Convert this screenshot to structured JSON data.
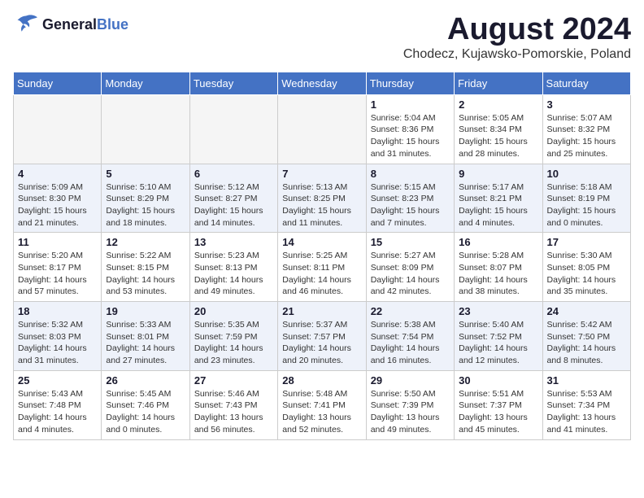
{
  "header": {
    "logo_line1": "General",
    "logo_line2": "Blue",
    "month_year": "August 2024",
    "location": "Chodecz, Kujawsko-Pomorskie, Poland"
  },
  "weekdays": [
    "Sunday",
    "Monday",
    "Tuesday",
    "Wednesday",
    "Thursday",
    "Friday",
    "Saturday"
  ],
  "weeks": [
    [
      {
        "day": "",
        "info": ""
      },
      {
        "day": "",
        "info": ""
      },
      {
        "day": "",
        "info": ""
      },
      {
        "day": "",
        "info": ""
      },
      {
        "day": "1",
        "info": "Sunrise: 5:04 AM\nSunset: 8:36 PM\nDaylight: 15 hours\nand 31 minutes."
      },
      {
        "day": "2",
        "info": "Sunrise: 5:05 AM\nSunset: 8:34 PM\nDaylight: 15 hours\nand 28 minutes."
      },
      {
        "day": "3",
        "info": "Sunrise: 5:07 AM\nSunset: 8:32 PM\nDaylight: 15 hours\nand 25 minutes."
      }
    ],
    [
      {
        "day": "4",
        "info": "Sunrise: 5:09 AM\nSunset: 8:30 PM\nDaylight: 15 hours\nand 21 minutes."
      },
      {
        "day": "5",
        "info": "Sunrise: 5:10 AM\nSunset: 8:29 PM\nDaylight: 15 hours\nand 18 minutes."
      },
      {
        "day": "6",
        "info": "Sunrise: 5:12 AM\nSunset: 8:27 PM\nDaylight: 15 hours\nand 14 minutes."
      },
      {
        "day": "7",
        "info": "Sunrise: 5:13 AM\nSunset: 8:25 PM\nDaylight: 15 hours\nand 11 minutes."
      },
      {
        "day": "8",
        "info": "Sunrise: 5:15 AM\nSunset: 8:23 PM\nDaylight: 15 hours\nand 7 minutes."
      },
      {
        "day": "9",
        "info": "Sunrise: 5:17 AM\nSunset: 8:21 PM\nDaylight: 15 hours\nand 4 minutes."
      },
      {
        "day": "10",
        "info": "Sunrise: 5:18 AM\nSunset: 8:19 PM\nDaylight: 15 hours\nand 0 minutes."
      }
    ],
    [
      {
        "day": "11",
        "info": "Sunrise: 5:20 AM\nSunset: 8:17 PM\nDaylight: 14 hours\nand 57 minutes."
      },
      {
        "day": "12",
        "info": "Sunrise: 5:22 AM\nSunset: 8:15 PM\nDaylight: 14 hours\nand 53 minutes."
      },
      {
        "day": "13",
        "info": "Sunrise: 5:23 AM\nSunset: 8:13 PM\nDaylight: 14 hours\nand 49 minutes."
      },
      {
        "day": "14",
        "info": "Sunrise: 5:25 AM\nSunset: 8:11 PM\nDaylight: 14 hours\nand 46 minutes."
      },
      {
        "day": "15",
        "info": "Sunrise: 5:27 AM\nSunset: 8:09 PM\nDaylight: 14 hours\nand 42 minutes."
      },
      {
        "day": "16",
        "info": "Sunrise: 5:28 AM\nSunset: 8:07 PM\nDaylight: 14 hours\nand 38 minutes."
      },
      {
        "day": "17",
        "info": "Sunrise: 5:30 AM\nSunset: 8:05 PM\nDaylight: 14 hours\nand 35 minutes."
      }
    ],
    [
      {
        "day": "18",
        "info": "Sunrise: 5:32 AM\nSunset: 8:03 PM\nDaylight: 14 hours\nand 31 minutes."
      },
      {
        "day": "19",
        "info": "Sunrise: 5:33 AM\nSunset: 8:01 PM\nDaylight: 14 hours\nand 27 minutes."
      },
      {
        "day": "20",
        "info": "Sunrise: 5:35 AM\nSunset: 7:59 PM\nDaylight: 14 hours\nand 23 minutes."
      },
      {
        "day": "21",
        "info": "Sunrise: 5:37 AM\nSunset: 7:57 PM\nDaylight: 14 hours\nand 20 minutes."
      },
      {
        "day": "22",
        "info": "Sunrise: 5:38 AM\nSunset: 7:54 PM\nDaylight: 14 hours\nand 16 minutes."
      },
      {
        "day": "23",
        "info": "Sunrise: 5:40 AM\nSunset: 7:52 PM\nDaylight: 14 hours\nand 12 minutes."
      },
      {
        "day": "24",
        "info": "Sunrise: 5:42 AM\nSunset: 7:50 PM\nDaylight: 14 hours\nand 8 minutes."
      }
    ],
    [
      {
        "day": "25",
        "info": "Sunrise: 5:43 AM\nSunset: 7:48 PM\nDaylight: 14 hours\nand 4 minutes."
      },
      {
        "day": "26",
        "info": "Sunrise: 5:45 AM\nSunset: 7:46 PM\nDaylight: 14 hours\nand 0 minutes."
      },
      {
        "day": "27",
        "info": "Sunrise: 5:46 AM\nSunset: 7:43 PM\nDaylight: 13 hours\nand 56 minutes."
      },
      {
        "day": "28",
        "info": "Sunrise: 5:48 AM\nSunset: 7:41 PM\nDaylight: 13 hours\nand 52 minutes."
      },
      {
        "day": "29",
        "info": "Sunrise: 5:50 AM\nSunset: 7:39 PM\nDaylight: 13 hours\nand 49 minutes."
      },
      {
        "day": "30",
        "info": "Sunrise: 5:51 AM\nSunset: 7:37 PM\nDaylight: 13 hours\nand 45 minutes."
      },
      {
        "day": "31",
        "info": "Sunrise: 5:53 AM\nSunset: 7:34 PM\nDaylight: 13 hours\nand 41 minutes."
      }
    ]
  ]
}
